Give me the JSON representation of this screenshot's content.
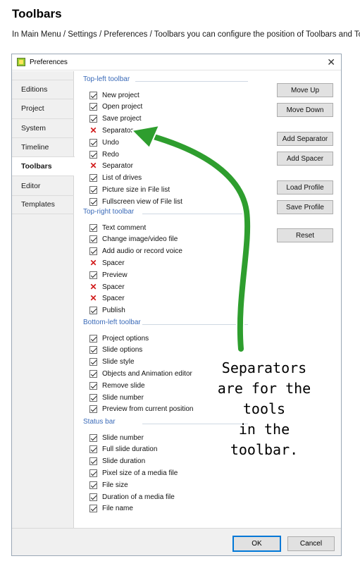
{
  "page": {
    "title": "Toolbars",
    "description": "In Main Menu / Settings / Preferences / Toolbars you can configure the position of Toolbars and Tools."
  },
  "window": {
    "title": "Preferences",
    "close_glyph": "✕"
  },
  "sidebar": {
    "active": "Toolbars",
    "items": [
      {
        "label": "Editions"
      },
      {
        "label": "Project"
      },
      {
        "label": "System"
      },
      {
        "label": "Timeline"
      },
      {
        "label": "Toolbars"
      },
      {
        "label": "Editor"
      },
      {
        "label": "Templates"
      }
    ]
  },
  "sections": [
    {
      "title": "Top-left toolbar",
      "items": [
        {
          "label": "New project",
          "state": "checked"
        },
        {
          "label": "Open project",
          "state": "checked"
        },
        {
          "label": "Save project",
          "state": "checked"
        },
        {
          "label": "Separator",
          "state": "x"
        },
        {
          "label": "Undo",
          "state": "checked"
        },
        {
          "label": "Redo",
          "state": "checked"
        },
        {
          "label": "Separator",
          "state": "x"
        },
        {
          "label": "List of drives",
          "state": "checked"
        },
        {
          "label": "Picture size in File list",
          "state": "checked"
        },
        {
          "label": "Fullscreen view of File list",
          "state": "checked"
        }
      ]
    },
    {
      "title": "Top-right toolbar",
      "items": [
        {
          "label": "Text comment",
          "state": "checked"
        },
        {
          "label": "Change image/video file",
          "state": "checked"
        },
        {
          "label": "Add audio or record voice",
          "state": "checked"
        },
        {
          "label": "Spacer",
          "state": "x"
        },
        {
          "label": "Preview",
          "state": "checked"
        },
        {
          "label": "Spacer",
          "state": "x"
        },
        {
          "label": "Spacer",
          "state": "x"
        },
        {
          "label": "Publish",
          "state": "checked"
        }
      ]
    },
    {
      "title": "Bottom-left toolbar",
      "items": [
        {
          "label": "Project options",
          "state": "checked"
        },
        {
          "label": "Slide options",
          "state": "checked"
        },
        {
          "label": "Slide style",
          "state": "checked"
        },
        {
          "label": "Objects and Animation editor",
          "state": "checked"
        },
        {
          "label": "Remove slide",
          "state": "checked"
        },
        {
          "label": "Slide number",
          "state": "checked"
        },
        {
          "label": "Preview from current position",
          "state": "checked"
        }
      ]
    },
    {
      "title": "Status bar",
      "items": [
        {
          "label": "Slide number",
          "state": "checked"
        },
        {
          "label": "Full slide duration",
          "state": "checked"
        },
        {
          "label": "Slide duration",
          "state": "checked"
        },
        {
          "label": "Pixel size of a media file",
          "state": "checked"
        },
        {
          "label": "File size",
          "state": "checked"
        },
        {
          "label": "Duration of a media file",
          "state": "checked"
        },
        {
          "label": "File name",
          "state": "checked"
        }
      ]
    }
  ],
  "buttons": {
    "move_up": "Move Up",
    "move_down": "Move Down",
    "add_separator": "Add Separator",
    "add_spacer": "Add Spacer",
    "load_profile": "Load Profile",
    "save_profile": "Save Profile",
    "reset": "Reset",
    "ok": "OK",
    "cancel": "Cancel"
  },
  "annotation": {
    "text": "Separators\nare for the\ntools\nin the\ntoolbar.",
    "arrow_color": "#2e9e2e"
  }
}
